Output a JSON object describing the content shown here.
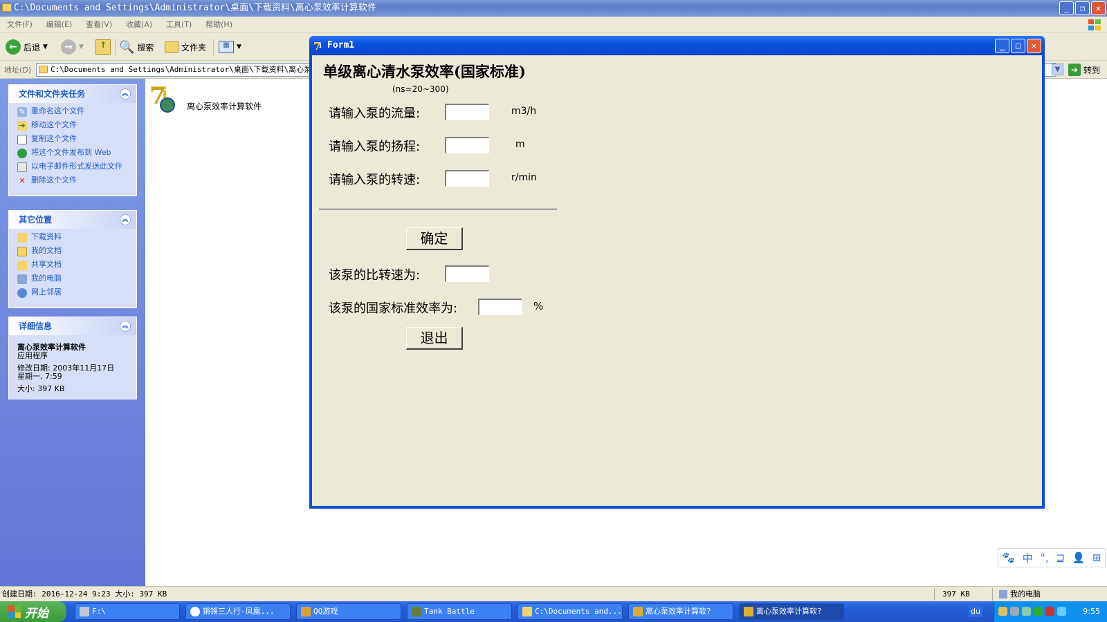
{
  "explorer": {
    "title": "C:\\Documents and Settings\\Administrator\\桌面\\下载资料\\离心泵效率计算软件",
    "menu": [
      "文件(F)",
      "编辑(E)",
      "查看(V)",
      "收藏(A)",
      "工具(T)",
      "帮助(H)"
    ],
    "toolbar": {
      "back": "后退",
      "search": "搜索",
      "folders": "文件夹"
    },
    "address_label": "地址(D)",
    "address_value": "C:\\Documents and Settings\\Administrator\\桌面\\下载资料\\离心泵效",
    "goto": "转到"
  },
  "taskpane": {
    "file_tasks": {
      "title": "文件和文件夹任务",
      "items": [
        "重命名这个文件",
        "移动这个文件",
        "复制这个文件",
        "将这个文件发布到 Web",
        "以电子邮件形式发送此文件",
        "删除这个文件"
      ]
    },
    "other_places": {
      "title": "其它位置",
      "items": [
        "下载资料",
        "我的文档",
        "共享文档",
        "我的电脑",
        "网上邻居"
      ]
    },
    "details": {
      "title": "详细信息",
      "name": "离心泵效率计算软件",
      "type": "应用程序",
      "modified_label": "修改日期: 2003年11月17日",
      "modified_time": "星期一, 7:59",
      "size": "大小: 397 KB"
    }
  },
  "file": {
    "name": "离心泵效率计算软件"
  },
  "statusbar": {
    "created": "创建日期: 2016-12-24 9:23 大小: 397 KB",
    "size": "397 KB",
    "location": "我的电脑"
  },
  "form1": {
    "window_title": "Form1",
    "heading": "单级离心清水泵效率(国家标准)",
    "subheading": "(ns=20~300)",
    "flow_label": "请输入泵的流量:",
    "flow_unit": "m3/h",
    "head_label": "请输入泵的扬程:",
    "head_unit": "m",
    "speed_label": "请输入泵的转速:",
    "speed_unit": "r/min",
    "ok_button": "确定",
    "specific_speed_label": "该泵的比转速为:",
    "efficiency_label": "该泵的国家标准效率为:",
    "efficiency_unit": "%",
    "exit_button": "退出"
  },
  "taskbar": {
    "start": "开始",
    "items": [
      "F:\\",
      "锵锵三人行-凤凰...",
      "QQ游戏",
      "Tank Battle",
      "C:\\Documents and...",
      "离心泵效率计算软?",
      "离心泵效率计算软?"
    ],
    "clock": "9:55"
  },
  "langbar": [
    "🐾",
    "中",
    "°,",
    "⊒",
    "👤",
    "⊞"
  ],
  "colors": {
    "xp_blue": "#0a4fd6",
    "form_bg": "#ece9d8",
    "task_link": "#215dc6"
  }
}
